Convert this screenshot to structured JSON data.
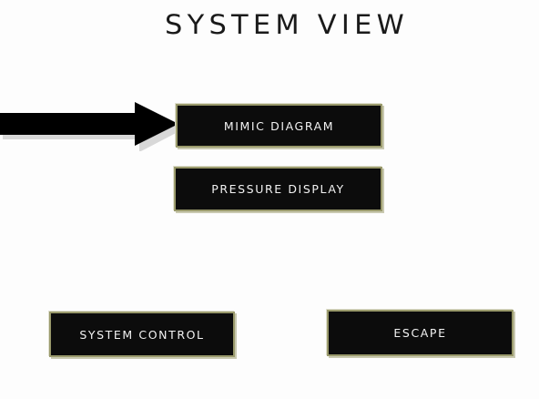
{
  "screen": {
    "title": "SYSTEM VIEW"
  },
  "buttons": {
    "mimic_diagram": "MIMIC DIAGRAM",
    "pressure_display": "PRESSURE DISPLAY",
    "system_control": "SYSTEM CONTROL",
    "escape": "ESCAPE"
  },
  "icons": {
    "pointer": "arrow-right-icon"
  },
  "colors": {
    "background": "#fdfdfd",
    "button_fill": "#0c0c0c",
    "button_text": "#f2f2f2",
    "button_border": "#9a9a6c",
    "title_text": "#1a1a1a"
  }
}
